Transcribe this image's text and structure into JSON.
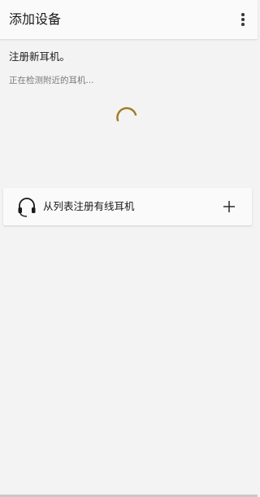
{
  "app_bar": {
    "title": "添加设备",
    "more_icon": "more-vertical-icon"
  },
  "main": {
    "heading": "注册新耳机。",
    "status": "正在检测附近的耳机...",
    "spinner_color": "#a07a23"
  },
  "wired_card": {
    "icon": "headset-icon",
    "label": "从列表注册有线耳机",
    "action_icon": "plus-icon"
  }
}
